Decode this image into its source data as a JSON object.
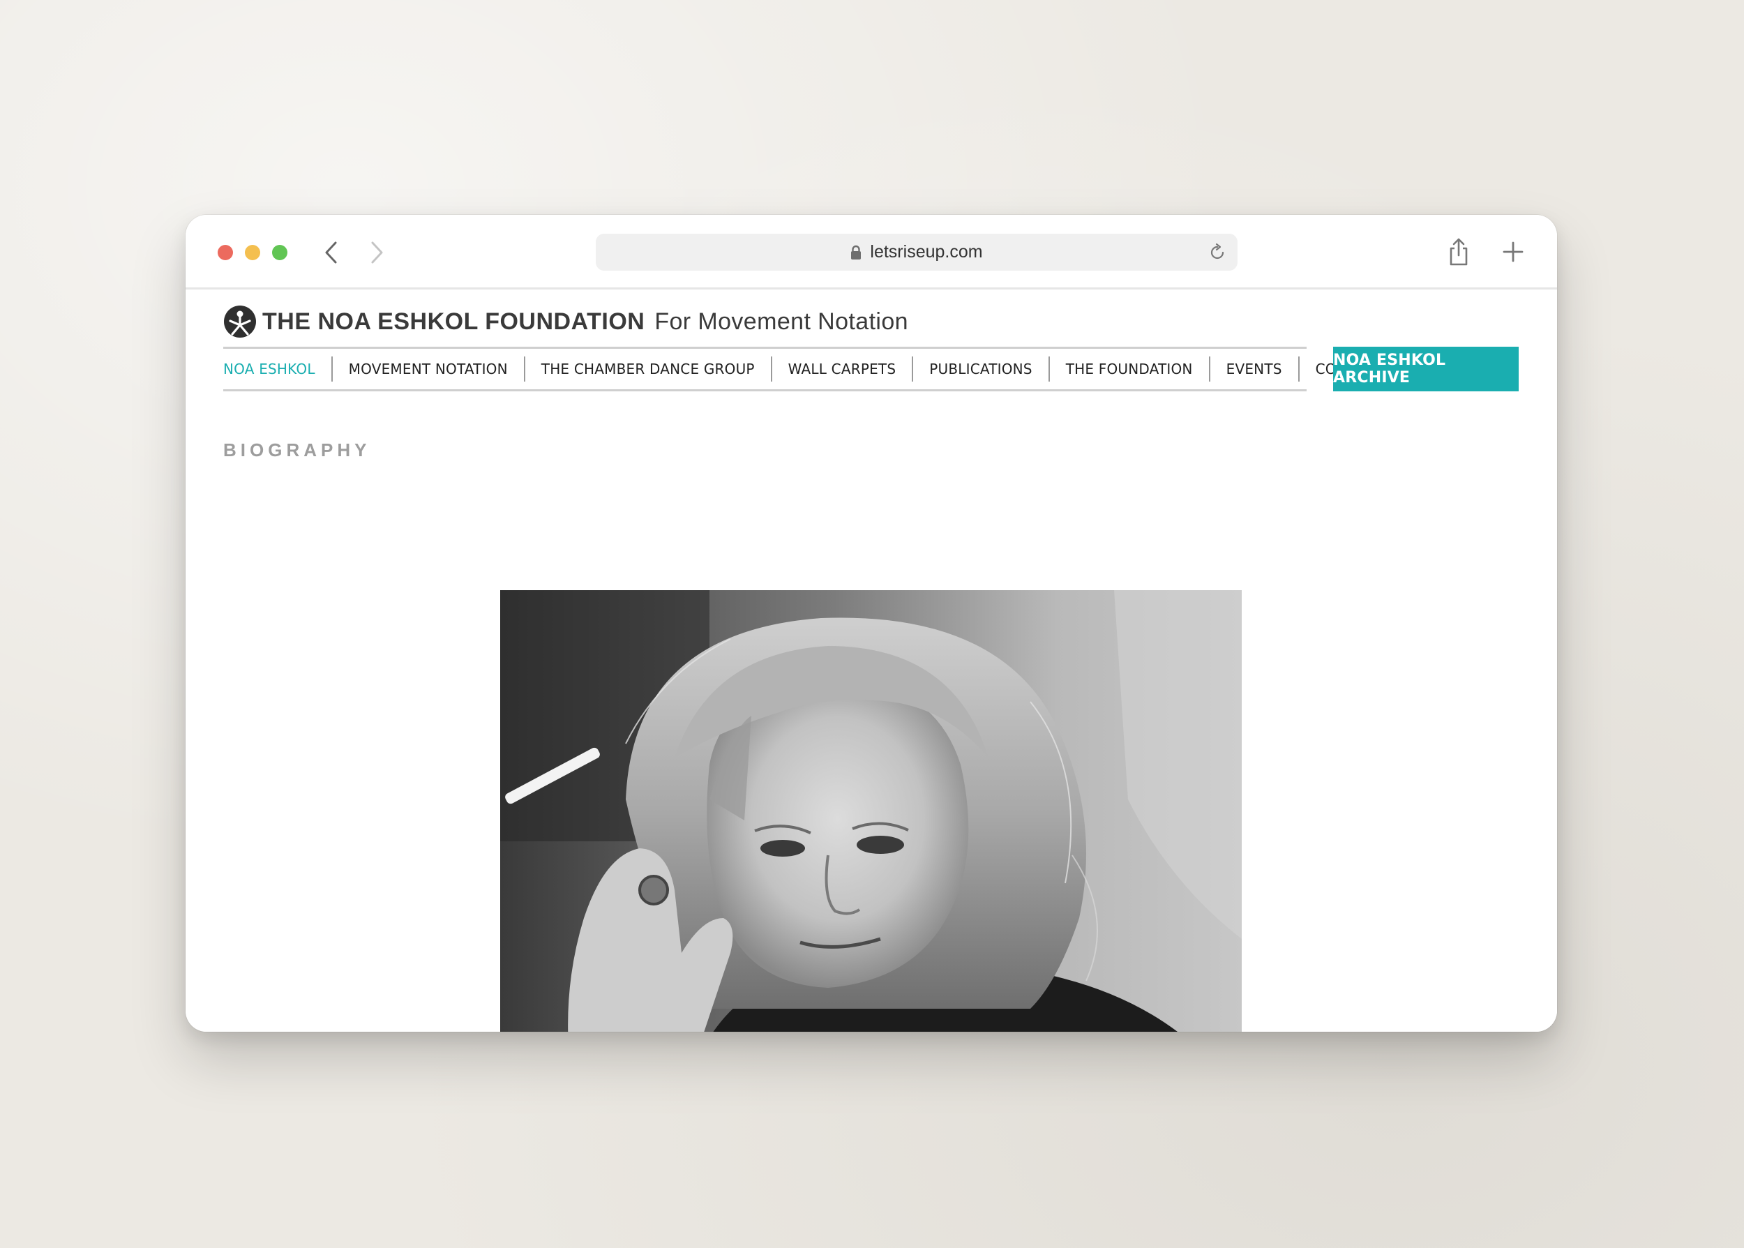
{
  "browser": {
    "url": "letsriseup.com"
  },
  "site": {
    "brand_bold": "THE NOA ESHKOL FOUNDATION",
    "brand_light": "For Movement Notation",
    "menu": [
      {
        "label": "NOA ESHKOL",
        "active": true
      },
      {
        "label": "MOVEMENT NOTATION",
        "active": false
      },
      {
        "label": "THE CHAMBER DANCE GROUP",
        "active": false
      },
      {
        "label": "WALL CARPETS",
        "active": false
      },
      {
        "label": "PUBLICATIONS",
        "active": false
      },
      {
        "label": "THE FOUNDATION",
        "active": false
      },
      {
        "label": "EVENTS",
        "active": false
      },
      {
        "label": "CONTACT",
        "active": false
      }
    ],
    "archive_button": "NOA ESHKOL ARCHIVE",
    "section_title": "BIOGRAPHY"
  },
  "colors": {
    "accent": "#1aaeb0",
    "text": "#222222",
    "muted": "#9d9d9d"
  },
  "icons": [
    "lock-icon",
    "reload-icon",
    "back-arrow-icon",
    "forward-arrow-icon",
    "share-icon",
    "new-tab-icon",
    "foundation-logo-icon"
  ]
}
